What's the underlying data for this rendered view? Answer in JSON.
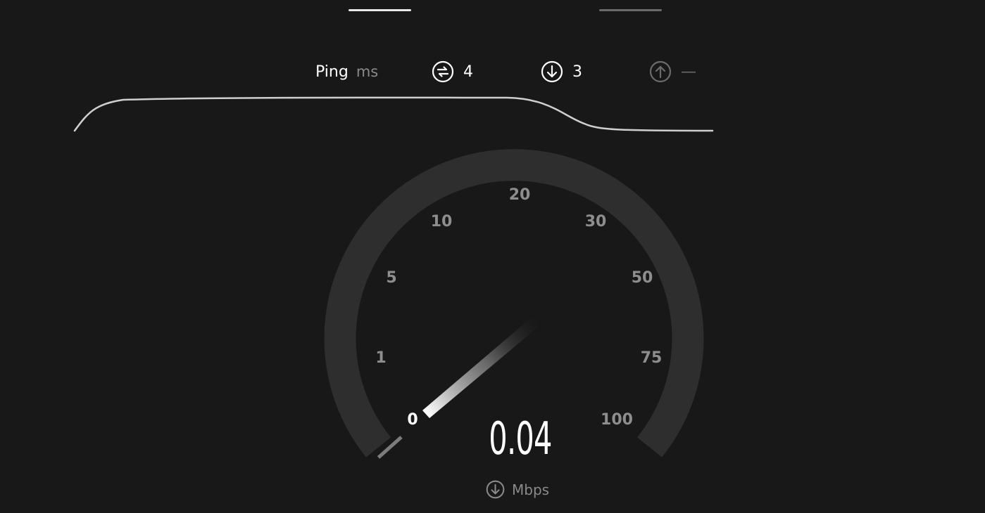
{
  "tabs": [
    {
      "name": "tab-1",
      "active": true
    },
    {
      "name": "tab-2",
      "active": false
    }
  ],
  "stats": {
    "ping_label": "Ping",
    "ping_unit": "ms",
    "jitter_icon": "jitter-icon",
    "jitter_value": "4",
    "download_icon": "download-arrow-icon",
    "download_value": "3",
    "upload_icon": "upload-arrow-icon",
    "upload_value": "—"
  },
  "gauge": {
    "tick_labels": [
      "0",
      "1",
      "5",
      "10",
      "20",
      "30",
      "50",
      "75",
      "100"
    ],
    "active_tick": "0",
    "speed_value": "0.04",
    "unit_icon": "download-arrow-icon",
    "unit": "Mbps"
  },
  "colors": {
    "background": "#181818",
    "track": "#2e2e2e",
    "tick": "#8e8e8e",
    "active": "#ffffff"
  }
}
